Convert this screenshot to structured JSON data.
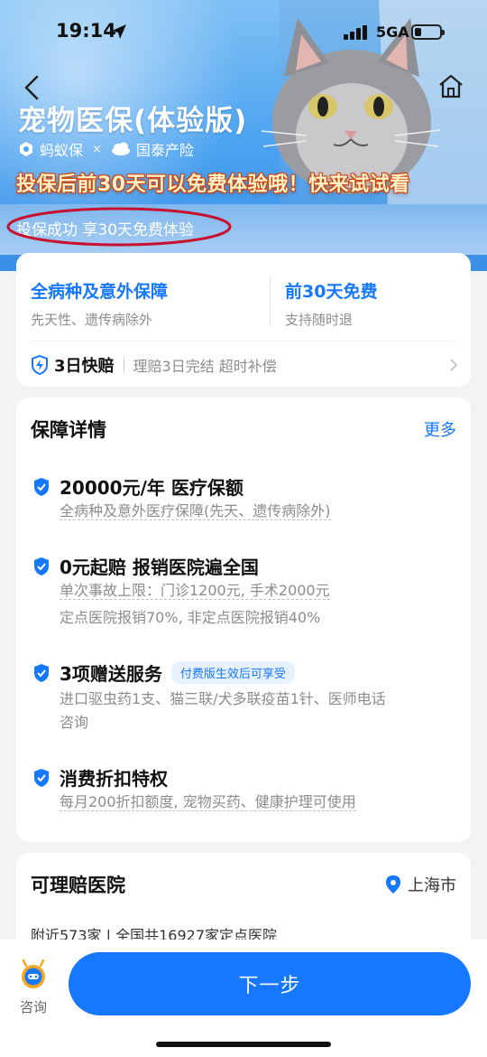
{
  "status_bar": {
    "time": "19:14",
    "network": "5GA"
  },
  "header": {
    "title": "宠物医保(体验版)",
    "brand_left": "蚂蚁保",
    "brand_sep": "×",
    "brand_right": "国泰产险",
    "promo": "投保后前30天可以免费体验哦！快来试试看",
    "success_note": "投保成功 享30天免费体验"
  },
  "features": [
    {
      "title": "全病种及意外保障",
      "sub": "先天性、遗传病除外"
    },
    {
      "title": "前30天免费",
      "sub": "支持随时退"
    }
  ],
  "claim": {
    "title": "3日快赔",
    "desc": "理赔3日完结  超时补偿"
  },
  "details": {
    "title": "保障详情",
    "more": "更多",
    "items": [
      {
        "title": "20000元/年 医疗保额",
        "lines": [
          "全病种及意外医疗保障(先天、遗传病除外)"
        ]
      },
      {
        "title": "0元起赔 报销医院遍全国",
        "lines": [
          "单次事故上限：门诊1200元, 手术2000元",
          "定点医院报销70%, 非定点医院报销40%"
        ]
      },
      {
        "title": "3项赠送服务",
        "tag": "付费版生效后可享受",
        "lines": [
          "进口驱虫药1支、猫三联/犬多联疫苗1针、医师电话",
          "咨询"
        ]
      },
      {
        "title": "消费折扣特权",
        "lines": [
          "每月200折扣额度, 宠物买药、健康护理可使用"
        ]
      }
    ]
  },
  "hospitals": {
    "title": "可理赔医院",
    "city": "上海市",
    "summary": "附近573家 | 全国共16927家定点医院"
  },
  "bottom": {
    "consult": "咨询",
    "next": "下一步"
  },
  "colors": {
    "primary": "#1677ff",
    "circle_mark": "#c8102e",
    "promo_text": "#fff1c8"
  },
  "icons": [
    "back-arrow-icon",
    "home-icon",
    "location-arrow-icon",
    "ant-logo-icon",
    "cloud-logo-icon",
    "lightning-shield-icon",
    "chevron-right-icon",
    "shield-check-icon",
    "location-pin-icon",
    "consult-bot-icon"
  ]
}
